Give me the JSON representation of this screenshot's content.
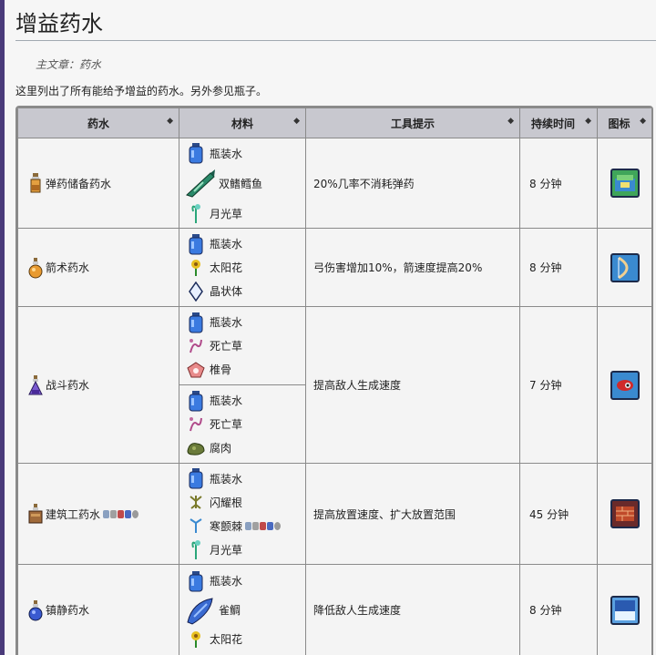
{
  "page": {
    "title": "增益药水",
    "hatnote_label": "主文章：",
    "hatnote_link": "药水",
    "intro": "这里列出了所有能给予增益的药水。另外参见瓶子。"
  },
  "table": {
    "headers": [
      "药水",
      "材料",
      "工具提示",
      "持续时间",
      "图标"
    ],
    "rows": [
      {
        "potion": "弹药储备药水",
        "materials": [
          [
            "瓶装水",
            "双鳍鳕鱼",
            "月光草"
          ]
        ],
        "tooltip": "20%几率不消耗弹药",
        "duration": "8 分钟",
        "icon": "ammo-box-icon"
      },
      {
        "potion": "箭术药水",
        "materials": [
          [
            "瓶装水",
            "太阳花",
            "晶状体"
          ]
        ],
        "tooltip": "弓伤害增加10%，箭速度提高20%",
        "duration": "8 分钟",
        "icon": "bow-icon"
      },
      {
        "potion": "战斗药水",
        "materials": [
          [
            "瓶装水",
            "死亡草",
            "椎骨"
          ],
          [
            "瓶装水",
            "死亡草",
            "腐肉"
          ]
        ],
        "tooltip": "提高敌人生成速度",
        "duration": "7 分钟",
        "icon": "battle-eye-icon"
      },
      {
        "potion": "建筑工药水",
        "materials": [
          [
            "瓶装水",
            "闪耀根",
            "寒颤棘",
            "月光草"
          ]
        ],
        "tooltip": "提高放置速度、扩大放置范围",
        "duration": "45 分钟",
        "icon": "builder-brick-icon"
      },
      {
        "potion": "镇静药水",
        "materials": [
          [
            "瓶装水",
            "雀鲷",
            "太阳花"
          ]
        ],
        "tooltip": "降低敌人生成速度",
        "duration": "8 分钟",
        "icon": "calm-wave-icon"
      }
    ]
  },
  "colors": {
    "header_bg": "#c8c8cf",
    "cell_bg": "#f4f4f4",
    "border": "#8a8a8a",
    "bottle_water": "#2f6fd6",
    "sunflower": "#e8c020",
    "moonglow": "#2aa67a"
  }
}
